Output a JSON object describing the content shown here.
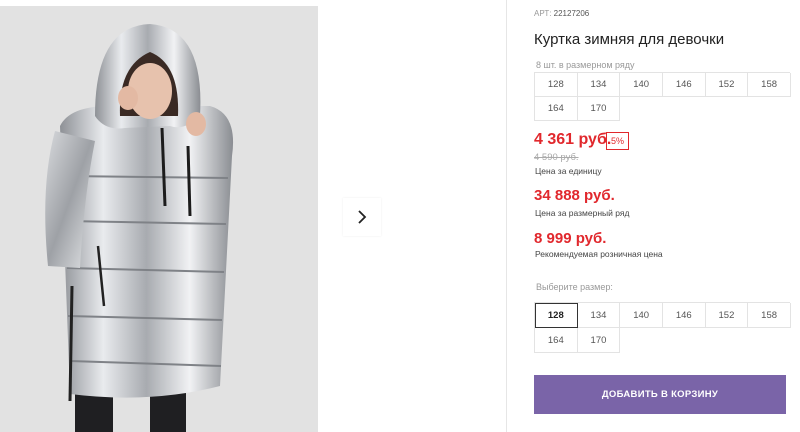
{
  "product": {
    "art_label": "АРТ:",
    "art_number": "22127206",
    "title": "Куртка зимняя для девочки"
  },
  "size_row": {
    "caption": "8 шт. в размерном ряду",
    "sizes": [
      "128",
      "134",
      "140",
      "146",
      "152",
      "158",
      "164",
      "170"
    ]
  },
  "prices": {
    "unit_price": "4 361 руб.",
    "discount": "5%",
    "old_price": "4 590 руб.",
    "unit_label": "Цена за единицу",
    "row_price": "34 888 руб.",
    "row_label": "Цена за размерный ряд",
    "retail_price": "8 999 руб.",
    "retail_label": "Рекомендуемая розничная цена"
  },
  "size_select": {
    "caption": "Выберите размер:",
    "sizes": [
      "128",
      "134",
      "140",
      "146",
      "152",
      "158",
      "164",
      "170"
    ],
    "selected": "128"
  },
  "cart": {
    "label": "ДОБАВИТЬ В КОРЗИНУ",
    "color": "#7a64a8"
  },
  "colors": {
    "price_red": "#e1282d"
  },
  "icons": {
    "next": "chevron-right-icon"
  }
}
